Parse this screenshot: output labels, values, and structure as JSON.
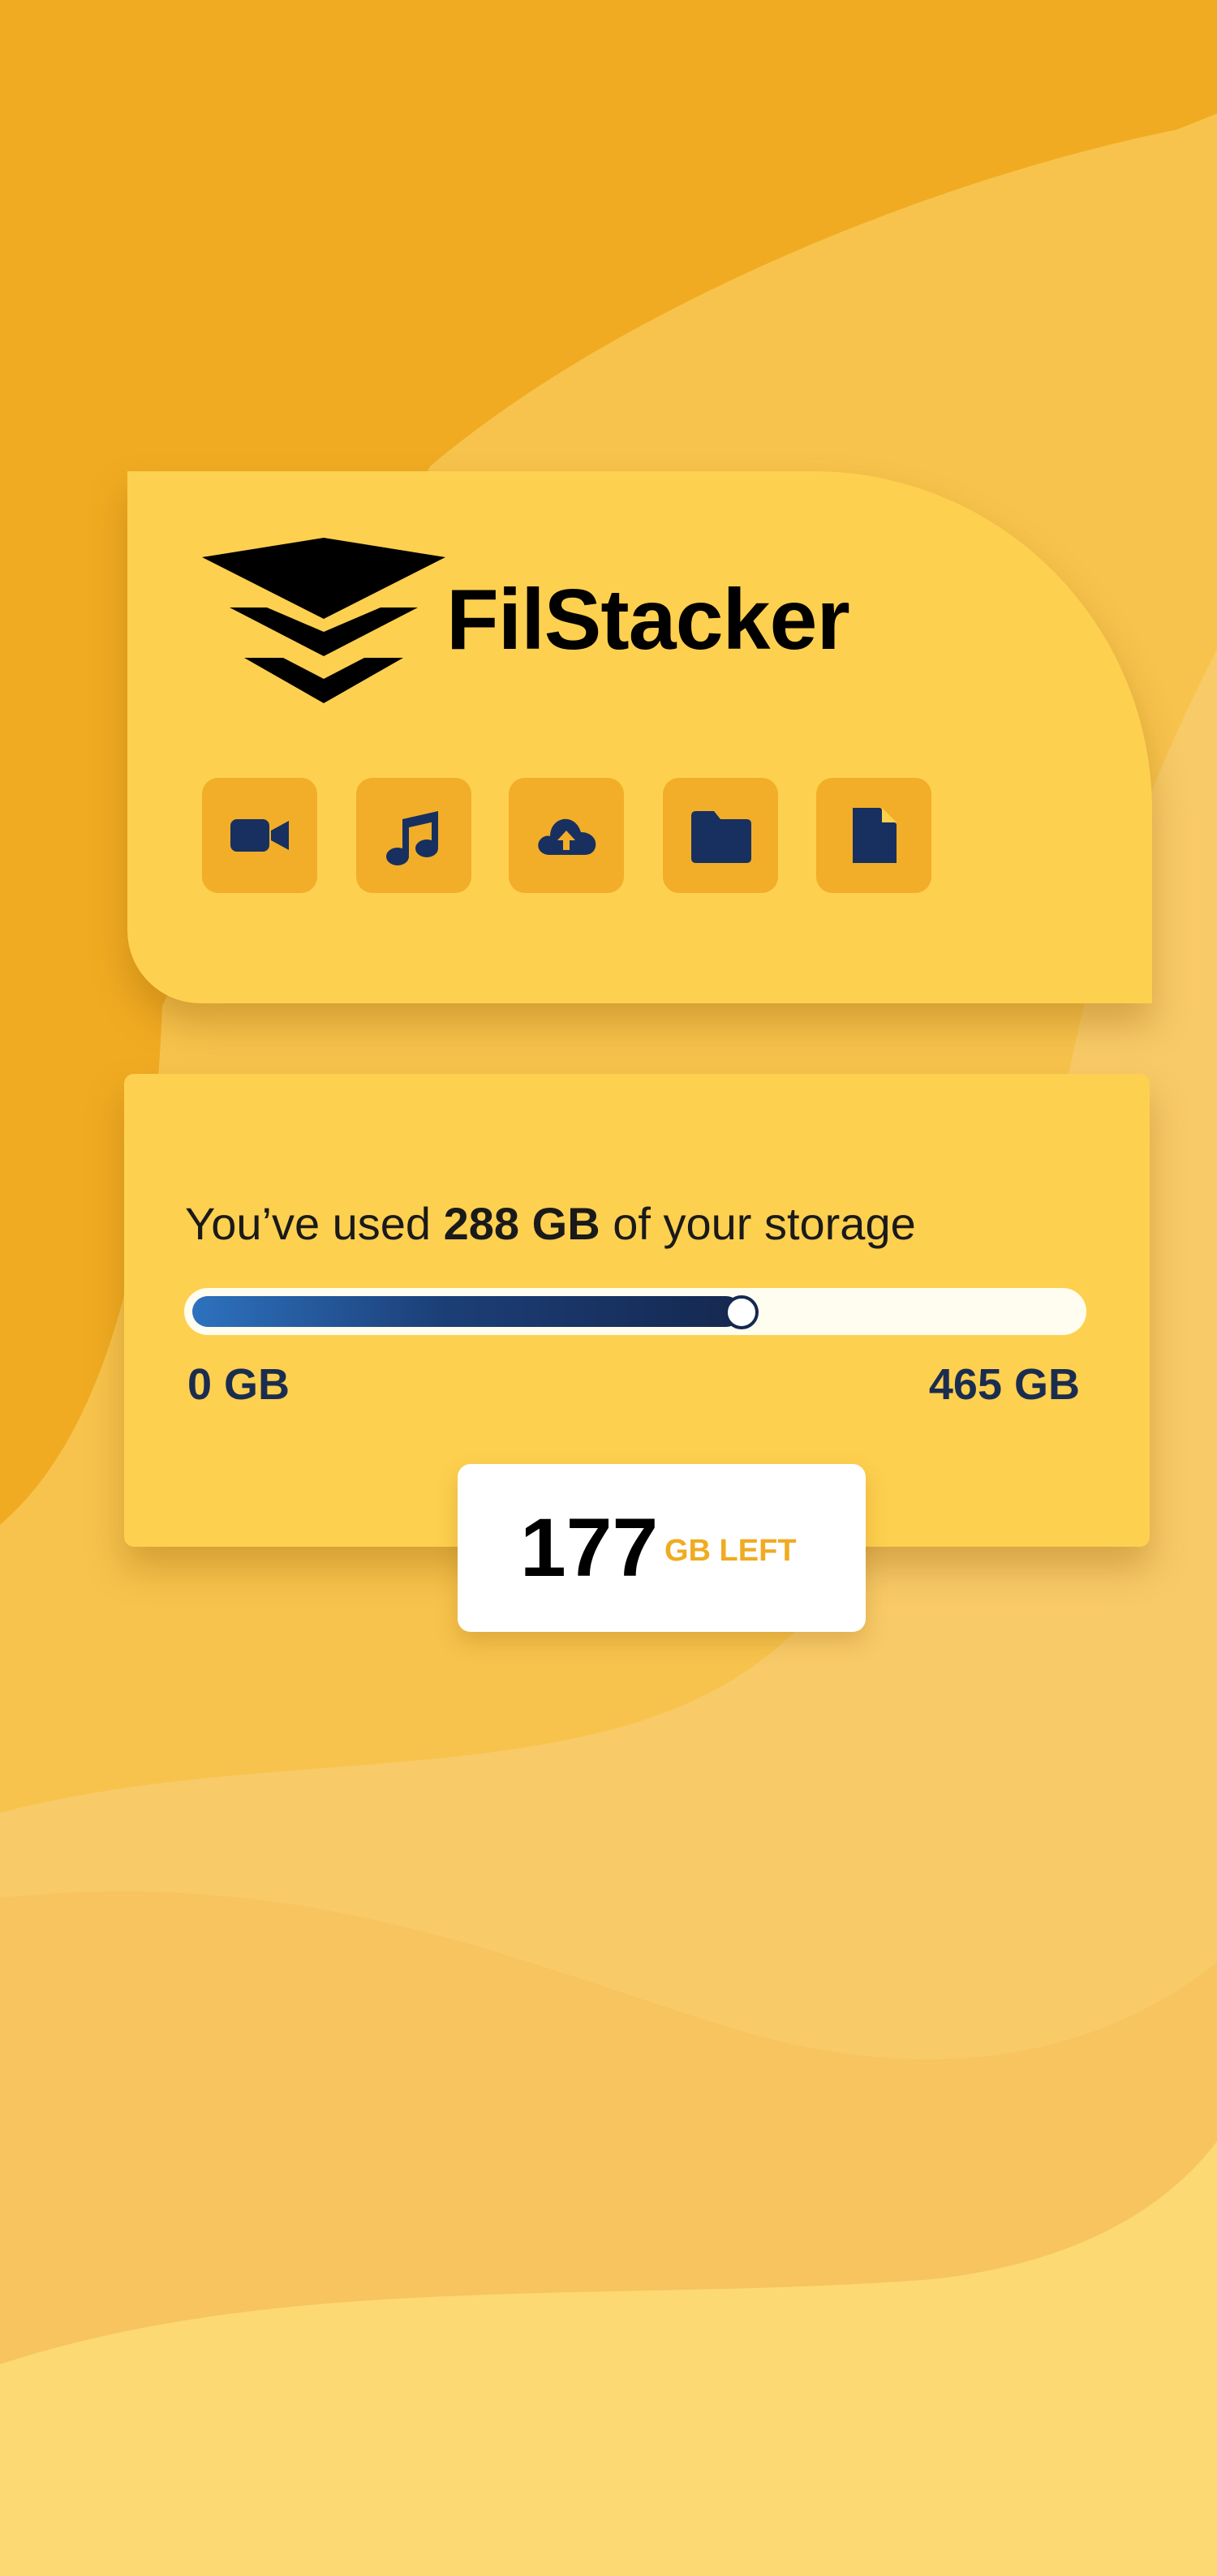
{
  "app": {
    "name": "FilStacker"
  },
  "file_types": [
    {
      "name": "video",
      "icon": "video-camera-icon"
    },
    {
      "name": "audio",
      "icon": "music-note-icon"
    },
    {
      "name": "upload",
      "icon": "cloud-upload-icon"
    },
    {
      "name": "folder",
      "icon": "folder-icon"
    },
    {
      "name": "document",
      "icon": "document-icon"
    }
  ],
  "storage": {
    "label_prefix": "You’ve used ",
    "used": "288 GB",
    "label_suffix": " of your storage",
    "min_label": "0 GB",
    "max_label": "465 GB",
    "used_fraction": 0.62,
    "left_value": "177",
    "left_unit": "GB LEFT"
  },
  "colors": {
    "background": "#f0ab22",
    "card": "#fed04f",
    "icon_tile": "#f2ae28",
    "icon": "#18305f",
    "accent_text": "#f0ab22",
    "progress_start": "#2d72bf",
    "progress_end": "#152850"
  }
}
